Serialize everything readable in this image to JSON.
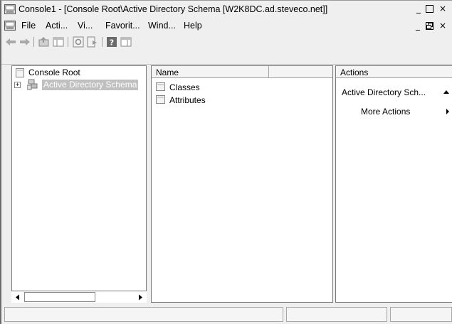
{
  "window": {
    "title": "Console1 - [Console Root\\Active Directory Schema [W2K8DC.ad.steveco.net]]",
    "min_glyph": "_",
    "restore_glyph": "□",
    "close_glyph": "×",
    "restore_child_glyph": "🗗"
  },
  "menu": {
    "items": [
      "File",
      "Acti...",
      "Vi...",
      "Favorit...",
      "Wind...",
      "Help"
    ]
  },
  "tree": {
    "root_label": "Console Root",
    "child_label": "Active Directory Schema",
    "expander": "+"
  },
  "list": {
    "column_header": "Name",
    "rows": [
      "Classes",
      "Attributes"
    ]
  },
  "actions": {
    "header": "Actions",
    "section": "Active Directory Sch...",
    "more": "More Actions"
  },
  "colors": {
    "selection": "#c0c0c0",
    "chrome": "#efefef"
  }
}
